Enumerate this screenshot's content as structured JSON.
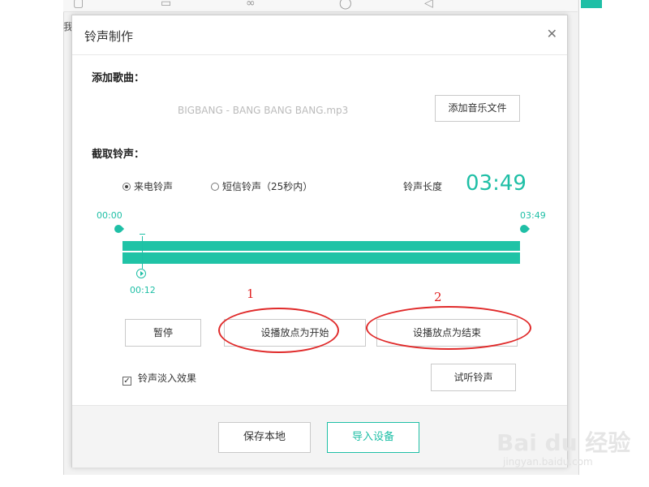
{
  "dialog": {
    "title": "铃声制作",
    "close_icon": "✕",
    "add_song_label": "添加歌曲：",
    "file_name": "BIGBANG - BANG BANG BANG.mp3",
    "add_file_button": "添加音乐文件",
    "cut_ringtone_label": "截取铃声：",
    "radio_call": "来电铃声",
    "radio_sms": "短信铃声（25秒内）",
    "length_label": "铃声长度",
    "length_value": "03:49",
    "start_time": "00:00",
    "end_time": "03:49",
    "playhead_time": "00:12",
    "playhead_position": 0.05,
    "pause_button": "暂停",
    "set_start_button": "设播放点为开始",
    "set_end_button": "设播放点为结束",
    "fade_in_label": "铃声淡入效果",
    "fade_in_checked": true,
    "preview_button": "试听铃声",
    "save_local_button": "保存本地",
    "import_device_button": "导入设备"
  },
  "annotations": {
    "marker_1": "1",
    "marker_2": "2"
  },
  "colors": {
    "accent": "#1fbfa6",
    "annotation": "#e02020"
  },
  "watermark": {
    "brand": "Bai du 经验",
    "url": "jingyan.baidu.com"
  },
  "background_app": {
    "partial_text": "我"
  }
}
